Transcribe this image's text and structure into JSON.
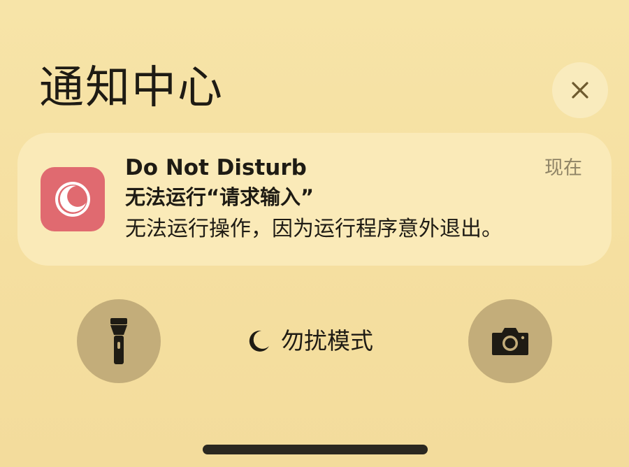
{
  "header": {
    "title": "通知中心"
  },
  "close_button": {
    "icon": "close-icon"
  },
  "notification": {
    "app_icon": "moon-icon",
    "app_name": "Do Not Disturb",
    "time": "现在",
    "title": "无法运行“请求输入”",
    "body": "无法运行操作，因为运行程序意外退出。"
  },
  "quick_actions": {
    "flashlight_icon": "flashlight-icon",
    "camera_icon": "camera-icon"
  },
  "focus": {
    "icon": "moon-icon",
    "label": "勿扰模式"
  },
  "colors": {
    "background": "#f6e2a5",
    "card": "#faeab8",
    "app_icon_bg": "#e06a70",
    "round_button_bg": "#c3ad7a",
    "close_button_bg": "#f9ebbd"
  }
}
